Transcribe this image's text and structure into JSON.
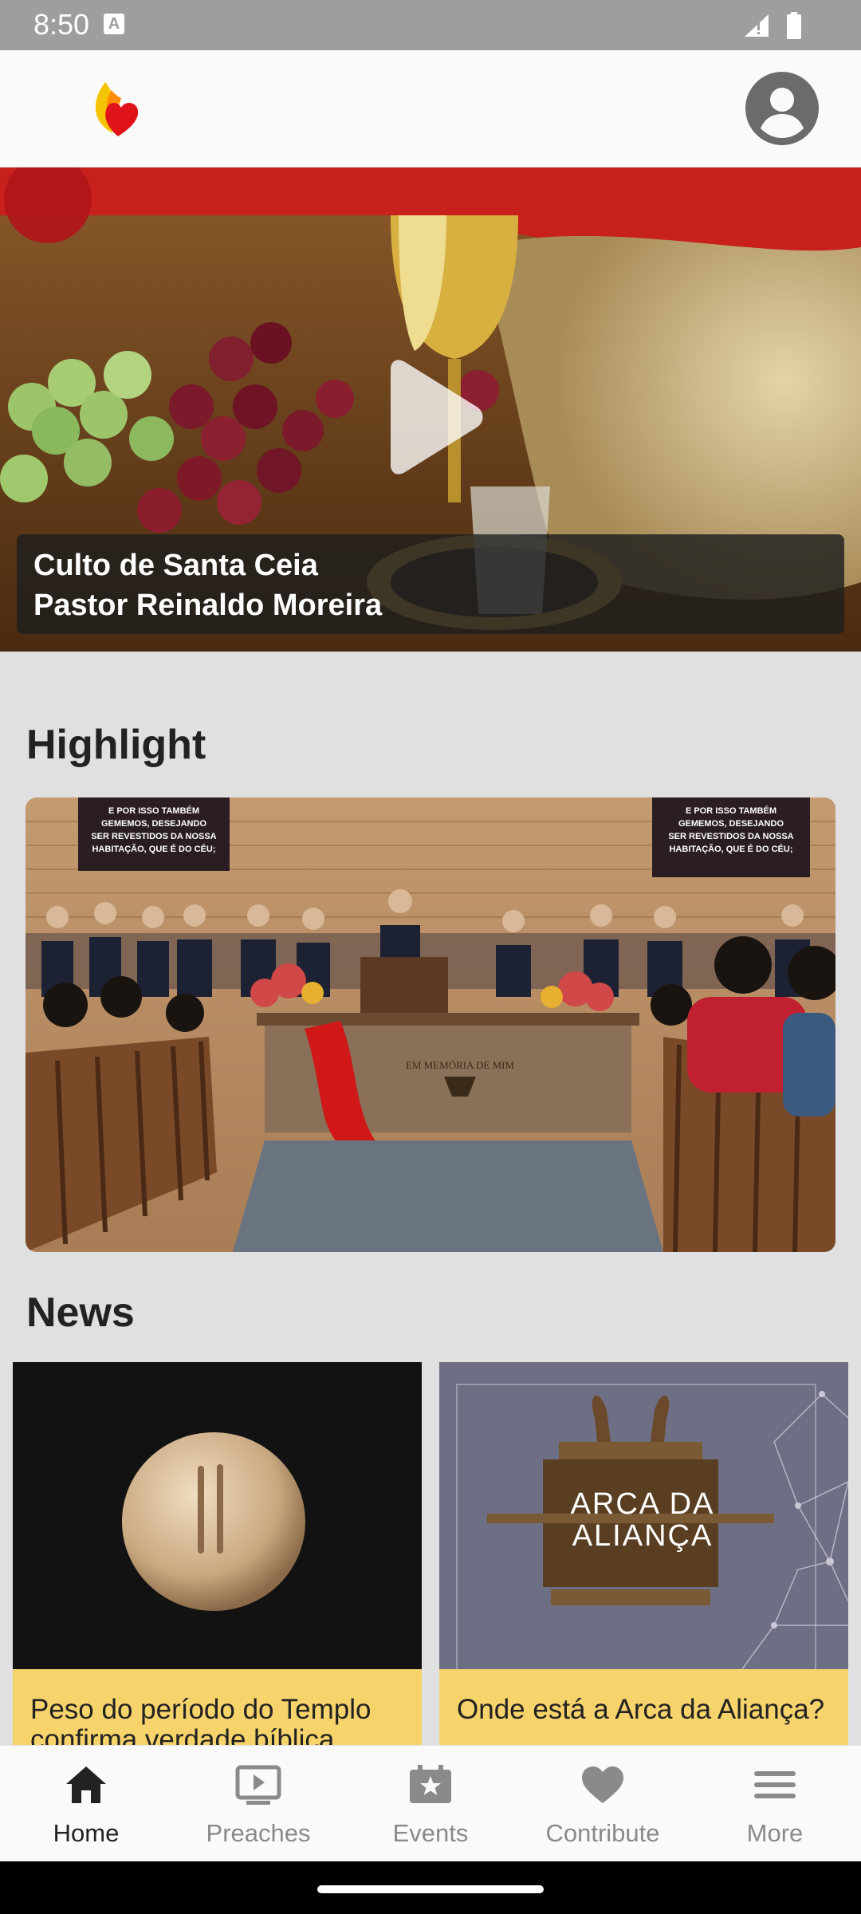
{
  "status_bar": {
    "time": "8:50",
    "notification_glyph": "A",
    "icons": [
      "signal-icon",
      "battery-icon"
    ]
  },
  "header": {
    "logo": "flame-heart-logo",
    "account_icon": "account-circle-icon"
  },
  "hero": {
    "title_line1": "Culto de Santa Ceia",
    "title_line2": "Pastor Reinaldo Moreira",
    "play_icon": "play-icon"
  },
  "highlight": {
    "title": "Highlight",
    "image": "church-service-photo",
    "banner_text": "E POR ISSO TAMBÉM GEMEMOS, DESEJANDO SER REVESTIDOS DA NOSSA HABITAÇÃO, QUE É DO CÉU;",
    "table_text": "EM MEMÓRIA DE MIM"
  },
  "news": {
    "title": "News",
    "items": [
      {
        "title": "Peso do período do Templo confirma verdade bíblica",
        "image": "stone-weight-photo"
      },
      {
        "title": "Onde está a Arca da Aliança?",
        "image": "ark-of-covenant-illustration",
        "image_text_line1": "ARCA DA",
        "image_text_line2": "ALIANÇA"
      }
    ]
  },
  "bottom_nav": {
    "items": [
      {
        "label": "Home",
        "icon": "home-icon",
        "active": true
      },
      {
        "label": "Preaches",
        "icon": "video-icon",
        "active": false
      },
      {
        "label": "Events",
        "icon": "star-calendar-icon",
        "active": false
      },
      {
        "label": "Contribute",
        "icon": "heart-icon",
        "active": false
      },
      {
        "label": "More",
        "icon": "menu-icon",
        "active": false
      }
    ]
  },
  "colors": {
    "accent_yellow": "#f7d36b",
    "background": "#e0e0e0",
    "status_bar": "#9e9e9e",
    "caption_overlay": "#1e1e1e"
  }
}
